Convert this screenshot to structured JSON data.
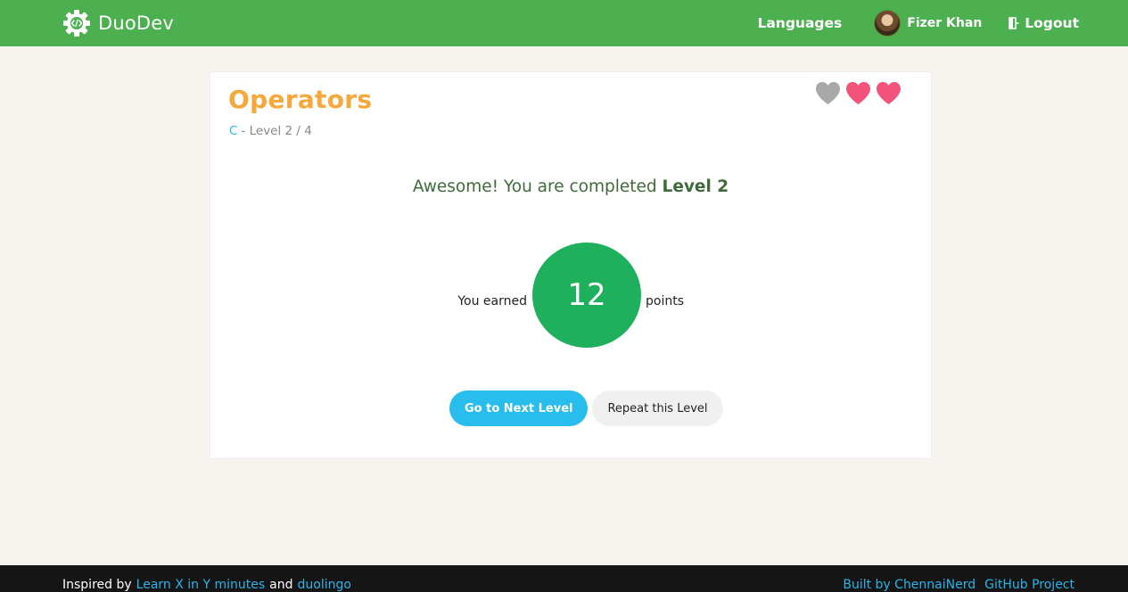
{
  "header": {
    "brand": "DuoDev",
    "brand_icon": "code-gear-icon",
    "nav_languages": "Languages",
    "user_name": "Fizer Khan",
    "logout": "Logout",
    "logout_icon": "logout-door-icon",
    "color": "#4caf50"
  },
  "lesson": {
    "title": "Operators",
    "language": "C",
    "level_text": "- Level 2 / 4",
    "hearts": [
      "lost",
      "full",
      "full"
    ]
  },
  "result": {
    "message_prefix": "Awesome! You are completed",
    "message_level": "Level 2",
    "earned_label": "You earned",
    "points": "12",
    "points_label": "points",
    "score_color": "#1fb05d"
  },
  "actions": {
    "next_level": "Go to Next Level",
    "repeat_level": "Repeat this Level"
  },
  "footer": {
    "inspired_by": "Inspired by",
    "link_learnx": "Learn X in Y minutes",
    "and": "and",
    "link_duolingo": "duolingo",
    "built_by": "Built by ChennaiNerd",
    "github": "GitHub Project"
  }
}
